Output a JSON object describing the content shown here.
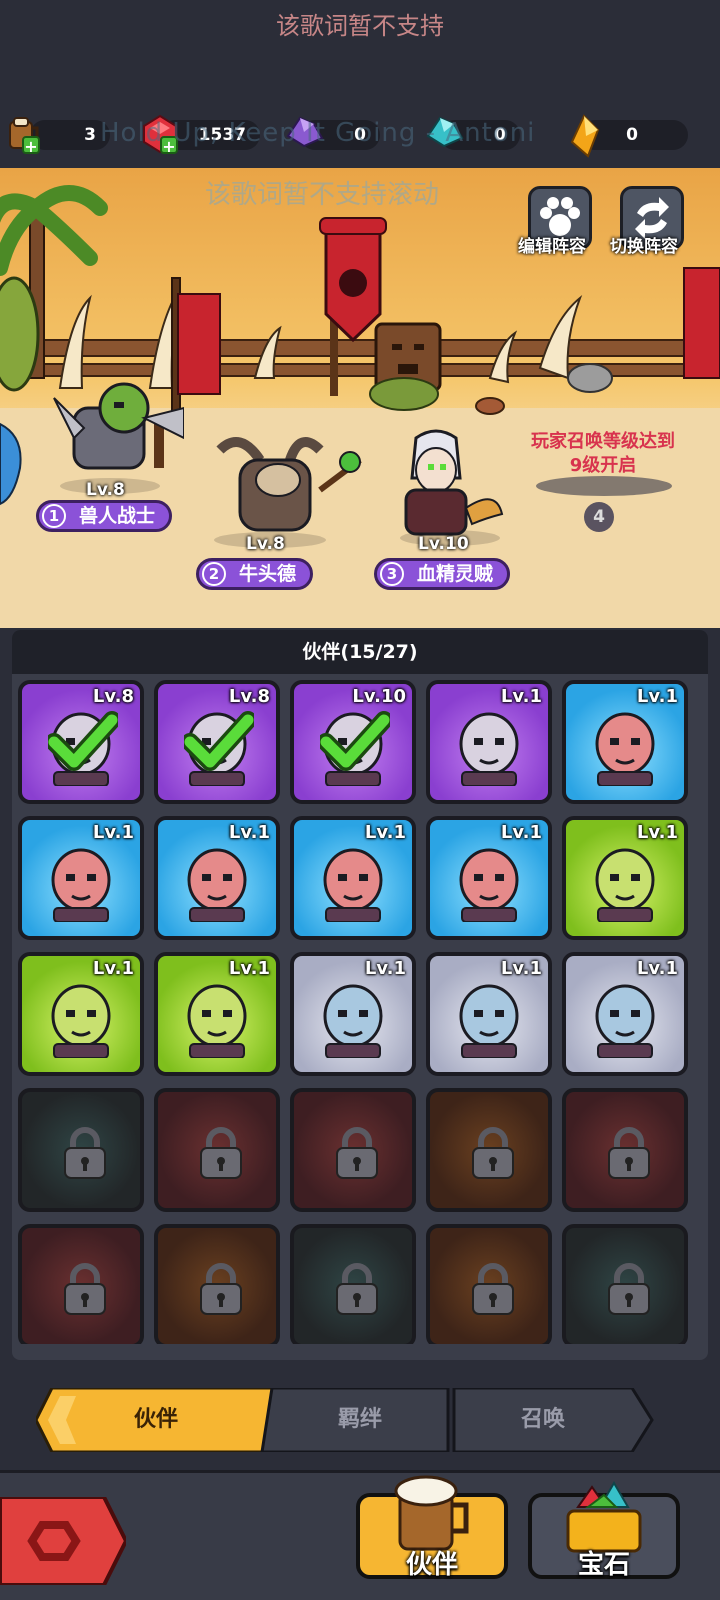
{
  "lyric_top": "该歌词暂不支持",
  "marquee": "Hold Up, Keep It Going - Antoni",
  "lyric_mid": "该歌词暂不支持滚动",
  "resources": [
    {
      "icon": "beer-mug-icon",
      "value": "3"
    },
    {
      "icon": "ruby-gem-icon",
      "value": "1537"
    },
    {
      "icon": "purple-crystal-icon",
      "value": "0"
    },
    {
      "icon": "teal-crystal-icon",
      "value": "0"
    },
    {
      "icon": "gold-crystal-icon",
      "value": "0"
    }
  ],
  "scene": {
    "edit_label": "编辑阵容",
    "switch_label": "切换阵容",
    "heroes": [
      {
        "num": "1",
        "name": "兽人战士",
        "level": "Lv.8"
      },
      {
        "num": "2",
        "name": "牛头德",
        "level": "Lv.8"
      },
      {
        "num": "3",
        "name": "血精灵贼",
        "level": "Lv.10"
      }
    ],
    "unlock_text": "玩家召唤等级达到9级开启",
    "slot4": "4"
  },
  "panel": {
    "title": "伙伴(15/27)"
  },
  "cards": [
    {
      "level": "Lv.8",
      "rarity": "purple",
      "selected": true
    },
    {
      "level": "Lv.8",
      "rarity": "purple",
      "selected": true
    },
    {
      "level": "Lv.10",
      "rarity": "purple",
      "selected": true
    },
    {
      "level": "Lv.1",
      "rarity": "purple",
      "selected": false
    },
    {
      "level": "Lv.1",
      "rarity": "blue",
      "selected": false
    },
    {
      "level": "Lv.1",
      "rarity": "blue",
      "selected": false
    },
    {
      "level": "Lv.1",
      "rarity": "blue",
      "selected": false
    },
    {
      "level": "Lv.1",
      "rarity": "blue",
      "selected": false
    },
    {
      "level": "Lv.1",
      "rarity": "blue",
      "selected": false
    },
    {
      "level": "Lv.1",
      "rarity": "green",
      "selected": false
    },
    {
      "level": "Lv.1",
      "rarity": "green",
      "selected": false
    },
    {
      "level": "Lv.1",
      "rarity": "green",
      "selected": false
    },
    {
      "level": "Lv.1",
      "rarity": "grey",
      "selected": false
    },
    {
      "level": "Lv.1",
      "rarity": "grey",
      "selected": false
    },
    {
      "level": "Lv.1",
      "rarity": "grey",
      "selected": false
    }
  ],
  "tabs": [
    {
      "label": "伙伴",
      "active": true
    },
    {
      "label": "羁绊",
      "active": false
    },
    {
      "label": "召唤",
      "active": false
    }
  ],
  "nav": {
    "partner_label": "伙伴",
    "gem_label": "宝石"
  },
  "colors": {
    "accent": "#f6b632",
    "purple": "#8a3fd0",
    "blue": "#2ba4e4",
    "green": "#7fbf1d",
    "grey": "#a9adc4"
  }
}
